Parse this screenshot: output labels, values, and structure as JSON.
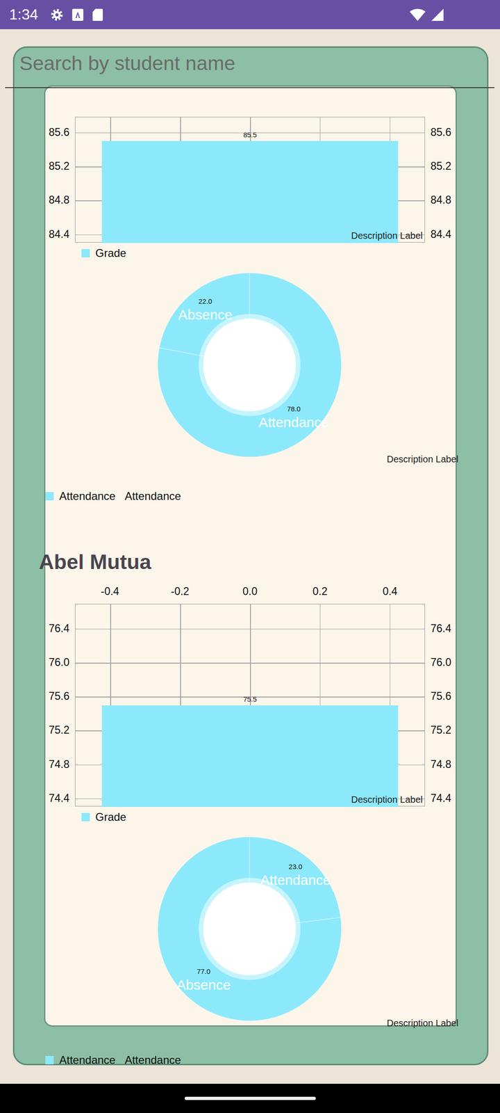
{
  "status_bar": {
    "time": "1:34"
  },
  "search": {
    "placeholder": "Search by student name"
  },
  "students": [
    {
      "grade_chart": {
        "top_ticks": [],
        "grid_x": [
          -0.4,
          -0.2,
          0,
          0.2,
          0.4
        ],
        "x_range": [
          -0.5,
          0.5
        ],
        "y_range": [
          84.3,
          85.78
        ],
        "y_ticks": [
          "85.6",
          "85.2",
          "84.8",
          "84.4"
        ],
        "values": [
          85.5
        ],
        "value_labels": [
          "85.5"
        ],
        "bar_width": 0.85,
        "legend": "Grade",
        "description": "Description Label"
      },
      "attendance_chart": {
        "slices": [
          {
            "label": "Attendance",
            "value": 78,
            "value_label": "78.0"
          },
          {
            "label": "Absence",
            "value": 22,
            "value_label": "22.0"
          }
        ],
        "legend": [
          {
            "label": "Attendance",
            "swatch": true
          },
          {
            "label": "Attendance",
            "swatch": false
          }
        ],
        "description": "Description Label"
      }
    },
    {
      "name": "Abel Mutua",
      "grade_chart": {
        "top_ticks": [
          "-0.4",
          "-0.2",
          "0.0",
          "0.2",
          "0.4"
        ],
        "grid_x": [
          -0.4,
          -0.2,
          0,
          0.2,
          0.4
        ],
        "x_range": [
          -0.5,
          0.5
        ],
        "y_range": [
          74.3,
          76.69
        ],
        "y_ticks": [
          "76.4",
          "76.0",
          "75.6",
          "75.2",
          "74.8",
          "74.4"
        ],
        "values": [
          75.5
        ],
        "value_labels": [
          "75.5"
        ],
        "bar_width": 0.85,
        "legend": "Grade",
        "description": "Description Label"
      },
      "attendance_chart": {
        "slices": [
          {
            "label": "Attendance",
            "value": 23,
            "value_label": "23.0"
          },
          {
            "label": "Absence",
            "value": 77,
            "value_label": "77.0"
          }
        ],
        "legend": [
          {
            "label": "Attendance",
            "swatch": true
          },
          {
            "label": "Attendance",
            "swatch": false
          }
        ],
        "description": "Description Label"
      }
    }
  ]
}
